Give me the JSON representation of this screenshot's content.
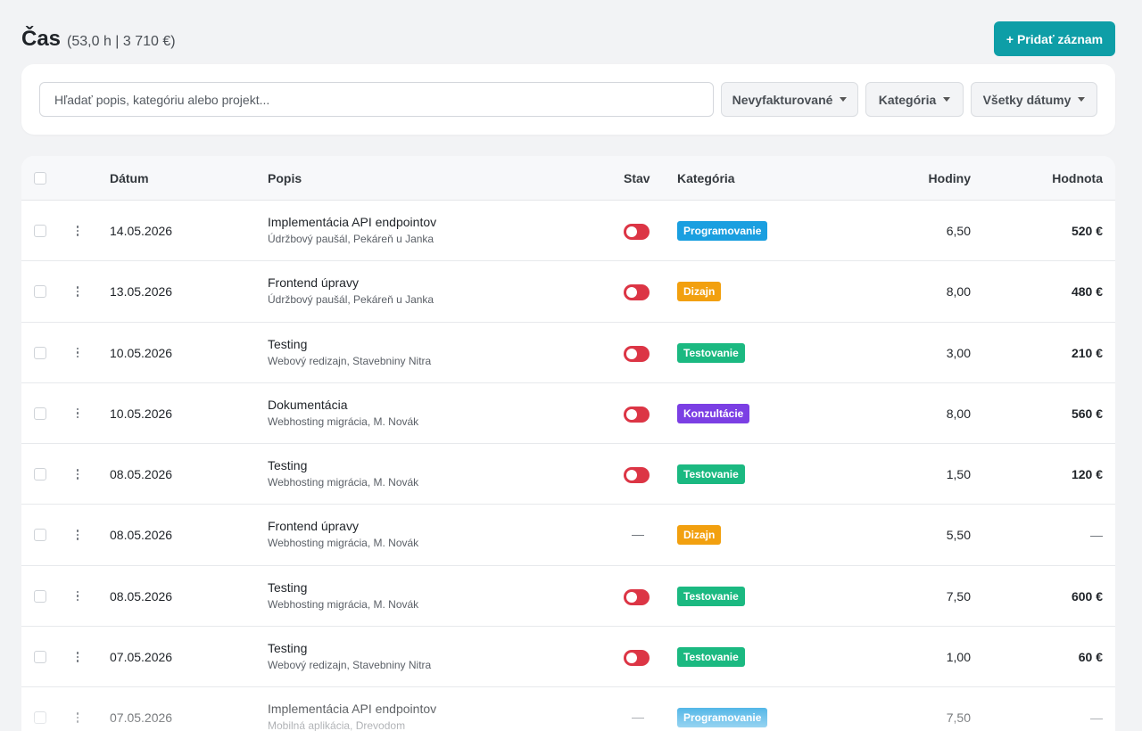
{
  "header": {
    "title": "Čas",
    "summary": "(53,0 h | 3 710 €)",
    "add_button": "+ Pridať záznam"
  },
  "filters": {
    "search_placeholder": "Hľadať popis, kategóriu alebo projekt...",
    "invoice_filter": "Nevyfakturované",
    "category_filter": "Kategória",
    "date_filter": "Všetky dátumy"
  },
  "table": {
    "columns": {
      "date": "Dátum",
      "description": "Popis",
      "status": "Stav",
      "category": "Kategória",
      "hours": "Hodiny",
      "value": "Hodnota"
    },
    "rows": [
      {
        "date": "14.05.2026",
        "title": "Implementácia API endpointov",
        "project": "Údržbový paušál, Pekáreň u Janka",
        "status": "toggle",
        "category": "Programovanie",
        "hours": "6,50",
        "value": "520 €"
      },
      {
        "date": "13.05.2026",
        "title": "Frontend úpravy",
        "project": "Údržbový paušál, Pekáreň u Janka",
        "status": "toggle",
        "category": "Dizajn",
        "hours": "8,00",
        "value": "480 €"
      },
      {
        "date": "10.05.2026",
        "title": "Testing",
        "project": "Webový redizajn, Stavebniny Nitra",
        "status": "toggle",
        "category": "Testovanie",
        "hours": "3,00",
        "value": "210 €"
      },
      {
        "date": "10.05.2026",
        "title": "Dokumentácia",
        "project": "Webhosting migrácia, M. Novák",
        "status": "toggle",
        "category": "Konzultácie",
        "hours": "8,00",
        "value": "560 €"
      },
      {
        "date": "08.05.2026",
        "title": "Testing",
        "project": "Webhosting migrácia, M. Novák",
        "status": "toggle",
        "category": "Testovanie",
        "hours": "1,50",
        "value": "120 €"
      },
      {
        "date": "08.05.2026",
        "title": "Frontend úpravy",
        "project": "Webhosting migrácia, M. Novák",
        "status": "dash",
        "category": "Dizajn",
        "hours": "5,50",
        "value": "—"
      },
      {
        "date": "08.05.2026",
        "title": "Testing",
        "project": "Webhosting migrácia, M. Novák",
        "status": "toggle",
        "category": "Testovanie",
        "hours": "7,50",
        "value": "600 €"
      },
      {
        "date": "07.05.2026",
        "title": "Testing",
        "project": "Webový redizajn, Stavebniny Nitra",
        "status": "toggle",
        "category": "Testovanie",
        "hours": "1,00",
        "value": "60 €"
      },
      {
        "date": "07.05.2026",
        "title": "Implementácia API endpointov",
        "project": "Mobilná aplikácia, Drevodom",
        "status": "dash",
        "category": "Programovanie",
        "hours": "7,50",
        "value": "—"
      }
    ],
    "status_dash": "—"
  },
  "colors": {
    "accent": "#0e9ea7",
    "toggle_off": "#dc3545",
    "Programovanie": "#1a9fe0",
    "Dizajn": "#f2a00f",
    "Testovanie": "#1bb981",
    "Konzultácie": "#7b3fe4"
  },
  "icons": {
    "row_menu": "kebab-menu-icon",
    "dropdown": "caret-down-icon"
  }
}
